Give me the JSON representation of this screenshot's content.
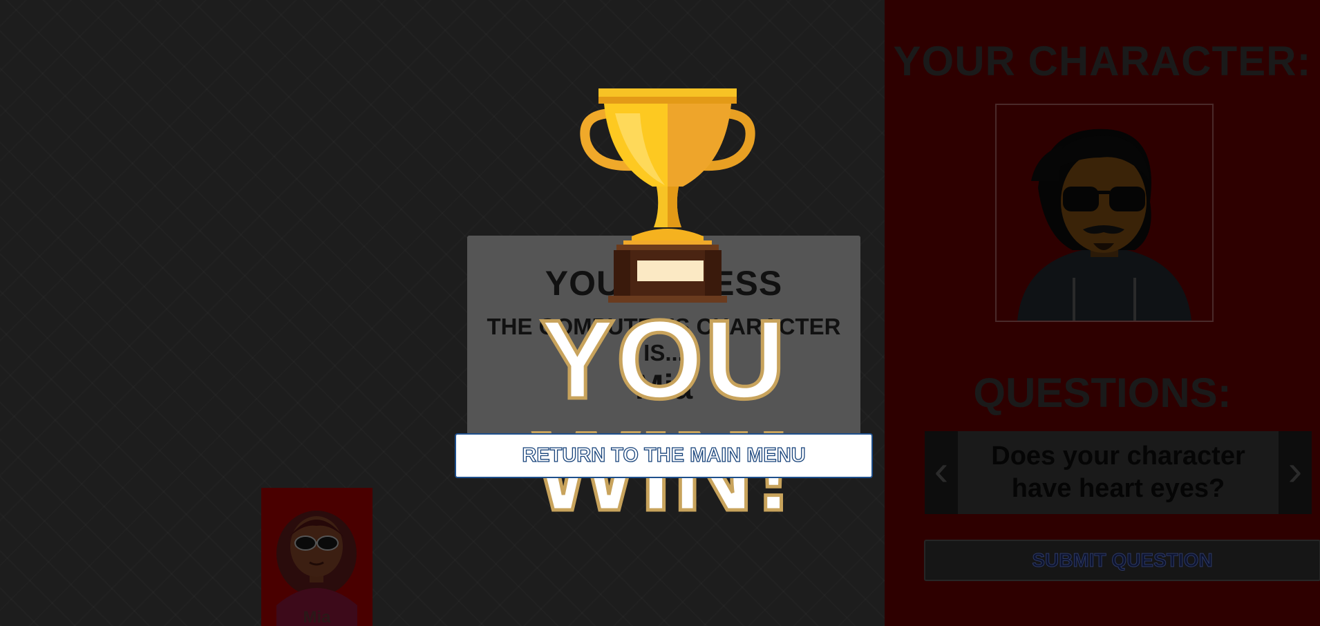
{
  "board": {
    "guess_title": "YOUR GUESS",
    "guess_subtitle": "THE COMPUTER'S CHARACTER IS...",
    "guess_name": "Mia",
    "card_label": "Mia"
  },
  "side_panel": {
    "your_character_title": "YOUR CHARACTER:",
    "questions_title": "QUESTIONS:",
    "question_text": "Does your character have heart eyes?",
    "prev_arrow": "‹",
    "next_arrow": "›",
    "submit_label": "SUBMIT QUESTION"
  },
  "overlay": {
    "win_text": "YOU WIN!",
    "return_label": "RETURN TO THE MAIN MENU",
    "trophy_icon": "trophy-icon"
  },
  "colors": {
    "board_bg": "#1d1d1d",
    "side_panel_bg": "#2e0000",
    "trophy_gold": "#f7c325",
    "win_outline": "#c8a35c",
    "button_text_blue": "#16427a"
  }
}
